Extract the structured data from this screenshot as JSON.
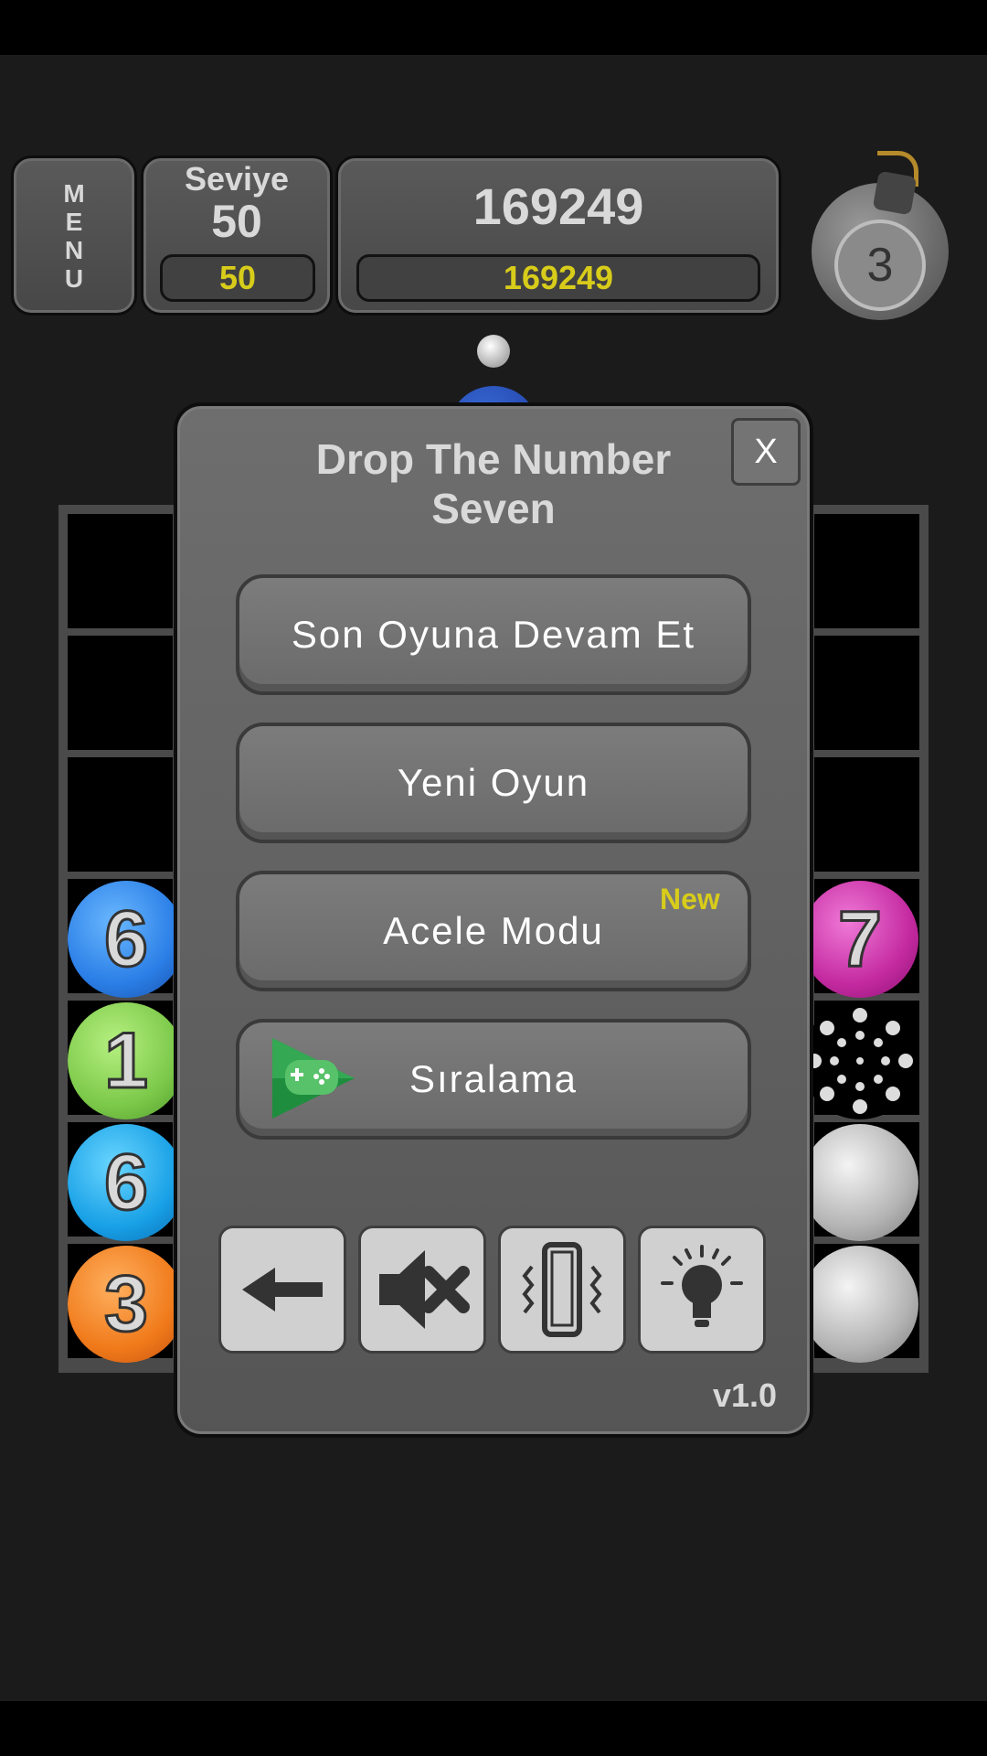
{
  "hud": {
    "menu_letters": [
      "M",
      "E",
      "N",
      "U"
    ],
    "level_label": "Seviye",
    "level_value": "50",
    "level_best": "50",
    "score": "169249",
    "high_score": "169249",
    "bomb_count": "3"
  },
  "board": {
    "left_column": [
      {
        "number": "6",
        "color": "#2a7ee6"
      },
      {
        "number": "1",
        "color": "#7cc94a"
      },
      {
        "number": "6",
        "color": "#18a0e6"
      },
      {
        "number": "3",
        "color": "#f07a1a"
      }
    ],
    "right_column": [
      {
        "number": "7",
        "color": "#c42aa0"
      },
      {
        "number": "",
        "type": "sparkle"
      },
      {
        "number": "",
        "type": "grey"
      },
      {
        "number": "",
        "type": "grey"
      }
    ]
  },
  "dialog": {
    "title": "Drop The Number Seven",
    "close_label": "X",
    "continue_label": "Son Oyuna Devam Et",
    "new_game_label": "Yeni Oyun",
    "rush_mode_label": "Acele Modu",
    "new_badge": "New",
    "leaderboard_label": "Sıralama",
    "toolbar_icons": [
      "back-arrow-icon",
      "sound-muted-icon",
      "vibration-icon",
      "hint-lightbulb-icon"
    ],
    "version": "v1.0"
  }
}
